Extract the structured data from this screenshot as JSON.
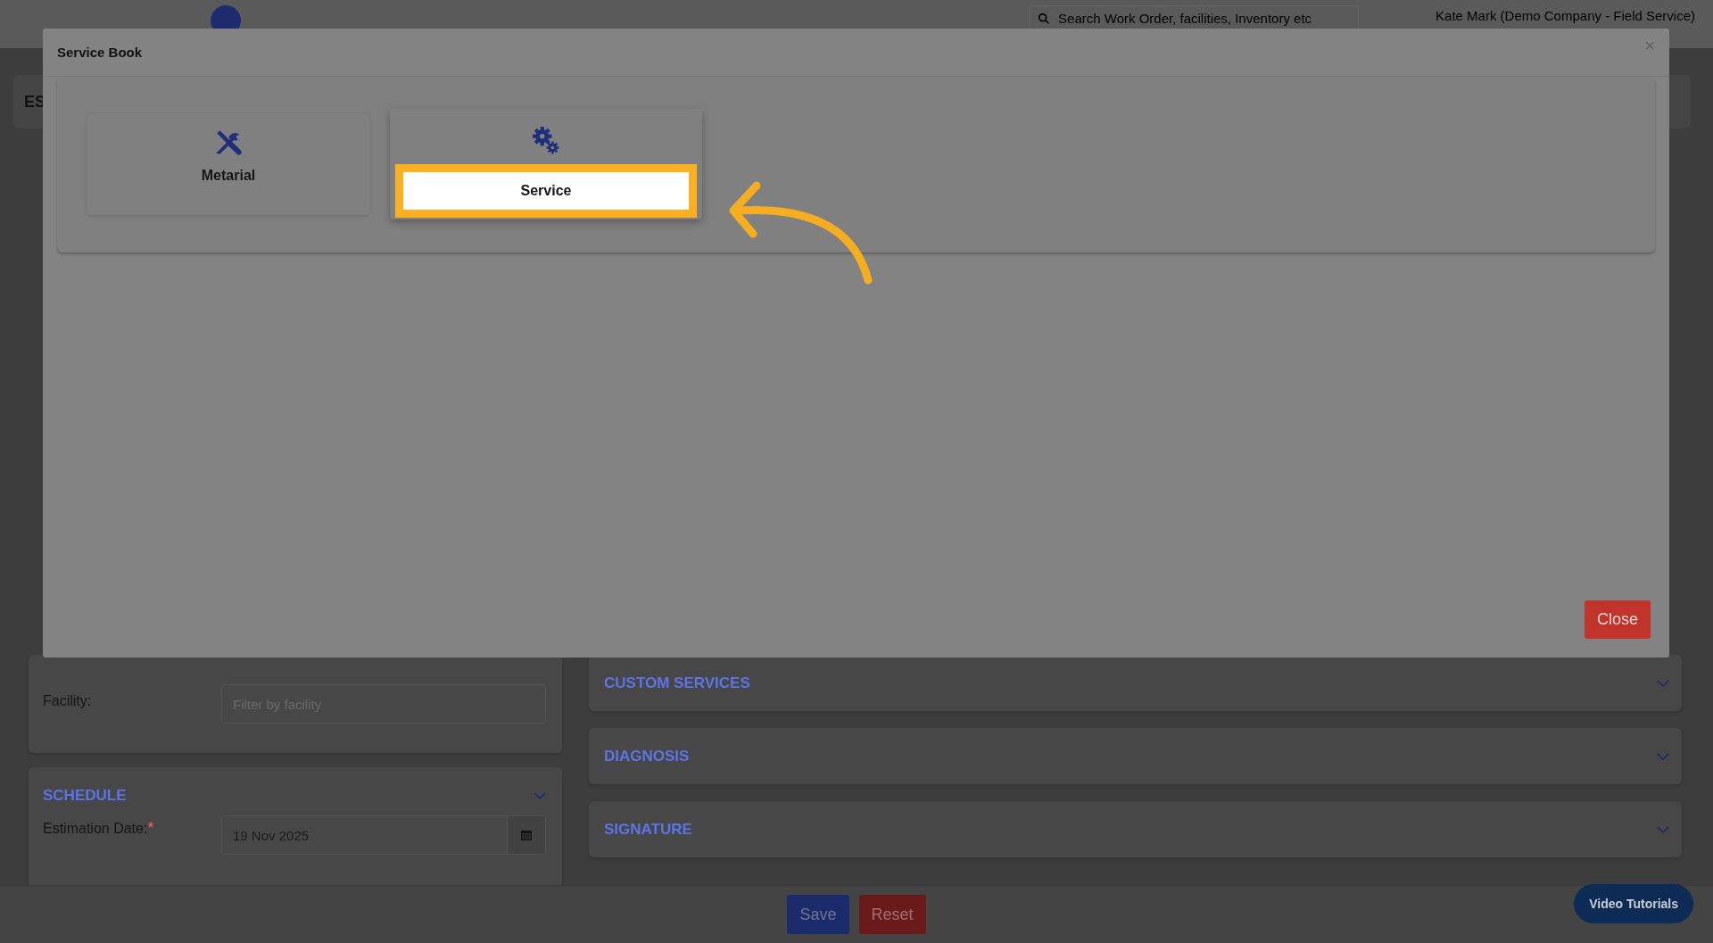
{
  "topbar": {
    "search": {
      "placeholder": "Search Work Order, facilities, Inventory etc"
    },
    "user": "Kate Mark (Demo Company - Field Service)"
  },
  "page_title": "ES",
  "facility": {
    "label": "Facility:",
    "placeholder": "Filter by facility"
  },
  "schedule": {
    "title": "SCHEDULE",
    "field": {
      "label": "Estimation Date:",
      "required_mark": "*",
      "value": "19 Nov 2025"
    }
  },
  "sections": [
    {
      "title": "CUSTOM SERVICES"
    },
    {
      "title": "DIAGNOSIS"
    },
    {
      "title": "SIGNATURE"
    }
  ],
  "footer": {
    "buttons": [
      {
        "label": "Save",
        "kind": "primary"
      },
      {
        "label": "Reset",
        "kind": "danger"
      }
    ],
    "video_tutorials": "Video Tutorials"
  },
  "modal": {
    "title": "Service Book",
    "close_glyph": "×",
    "tiles": [
      {
        "label": "Metarial",
        "selected": false
      },
      {
        "label": "Service",
        "selected": true
      }
    ],
    "close_button": "Close"
  }
}
